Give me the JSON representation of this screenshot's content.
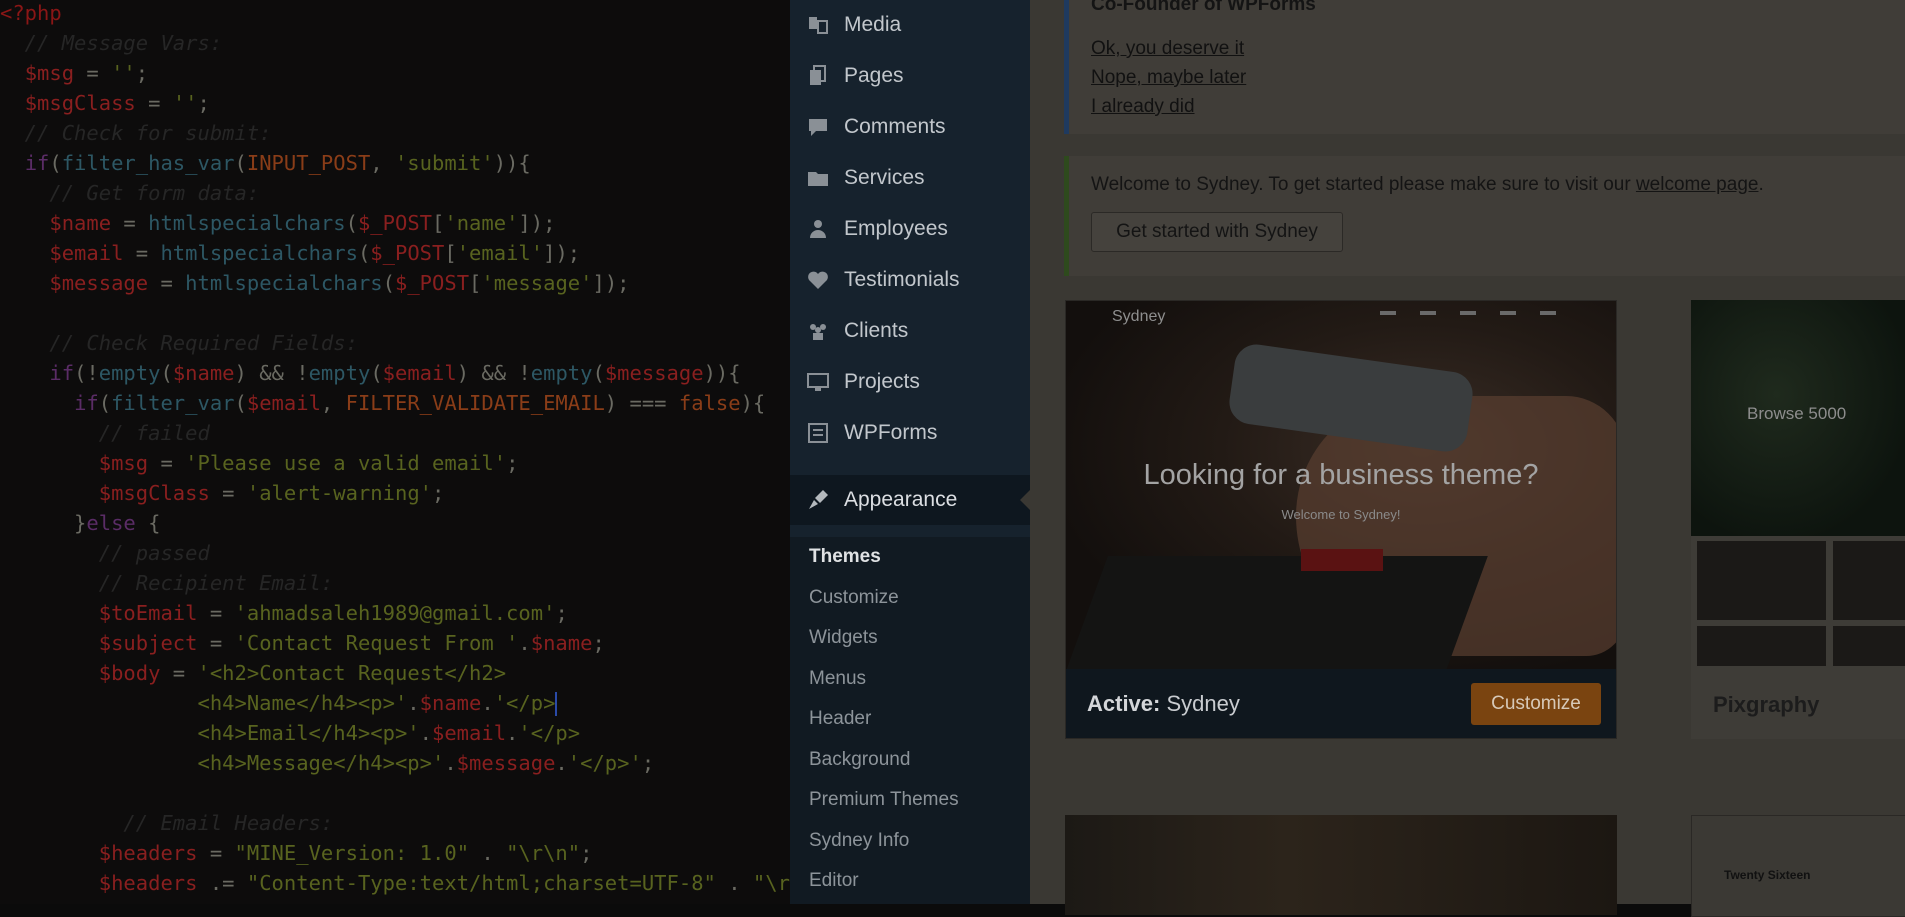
{
  "code": {
    "lines": [
      [
        [
          "tag",
          "<?php"
        ]
      ],
      [
        [
          "cmt",
          "  // Message Vars:"
        ]
      ],
      [
        [
          "pun",
          "  "
        ],
        [
          "var",
          "$msg"
        ],
        [
          "pun",
          " = "
        ],
        [
          "str",
          "''"
        ],
        [
          "pun",
          ";"
        ]
      ],
      [
        [
          "pun",
          "  "
        ],
        [
          "var",
          "$msgClass"
        ],
        [
          "pun",
          " = "
        ],
        [
          "str",
          "''"
        ],
        [
          "pun",
          ";"
        ]
      ],
      [
        [
          "cmt",
          "  // Check for submit:"
        ]
      ],
      [
        [
          "pun",
          "  "
        ],
        [
          "kw",
          "if"
        ],
        [
          "pun",
          "("
        ],
        [
          "fn",
          "filter_has_var"
        ],
        [
          "pun",
          "("
        ],
        [
          "const",
          "INPUT_POST"
        ],
        [
          "pun",
          ", "
        ],
        [
          "str",
          "'submit'"
        ],
        [
          "pun",
          "))"
        ],
        [
          "pun",
          "{"
        ]
      ],
      [
        [
          "cmt",
          "    // Get form data:"
        ]
      ],
      [
        [
          "pun",
          "    "
        ],
        [
          "var",
          "$name"
        ],
        [
          "pun",
          " = "
        ],
        [
          "fn",
          "htmlspecialchars"
        ],
        [
          "pun",
          "("
        ],
        [
          "var",
          "$_POST"
        ],
        [
          "pun",
          "["
        ],
        [
          "str",
          "'name'"
        ],
        [
          "pun",
          "]);"
        ]
      ],
      [
        [
          "pun",
          "    "
        ],
        [
          "var",
          "$email"
        ],
        [
          "pun",
          " = "
        ],
        [
          "fn",
          "htmlspecialchars"
        ],
        [
          "pun",
          "("
        ],
        [
          "var",
          "$_POST"
        ],
        [
          "pun",
          "["
        ],
        [
          "str",
          "'email'"
        ],
        [
          "pun",
          "]);"
        ]
      ],
      [
        [
          "pun",
          "    "
        ],
        [
          "var",
          "$message"
        ],
        [
          "pun",
          " = "
        ],
        [
          "fn",
          "htmlspecialchars"
        ],
        [
          "pun",
          "("
        ],
        [
          "var",
          "$_POST"
        ],
        [
          "pun",
          "["
        ],
        [
          "str",
          "'message'"
        ],
        [
          "pun",
          "]);"
        ]
      ],
      [
        [
          "pun",
          ""
        ]
      ],
      [
        [
          "cmt",
          "    // Check Required Fields:"
        ]
      ],
      [
        [
          "pun",
          "    "
        ],
        [
          "kw",
          "if"
        ],
        [
          "pun",
          "(!"
        ],
        [
          "fn",
          "empty"
        ],
        [
          "pun",
          "("
        ],
        [
          "var",
          "$name"
        ],
        [
          "pun",
          ") && !"
        ],
        [
          "fn",
          "empty"
        ],
        [
          "pun",
          "("
        ],
        [
          "var",
          "$email"
        ],
        [
          "pun",
          ") && !"
        ],
        [
          "fn",
          "empty"
        ],
        [
          "pun",
          "("
        ],
        [
          "var",
          "$message"
        ],
        [
          "pun",
          "))"
        ],
        [
          "pun",
          "{"
        ]
      ],
      [
        [
          "pun",
          "      "
        ],
        [
          "kw",
          "if"
        ],
        [
          "pun",
          "("
        ],
        [
          "fn",
          "filter_var"
        ],
        [
          "pun",
          "("
        ],
        [
          "var",
          "$email"
        ],
        [
          "pun",
          ", "
        ],
        [
          "const",
          "FILTER_VALIDATE_EMAIL"
        ],
        [
          "pun",
          ") === "
        ],
        [
          "const",
          "false"
        ],
        [
          "pun",
          "){"
        ]
      ],
      [
        [
          "cmt",
          "        // failed"
        ]
      ],
      [
        [
          "pun",
          "        "
        ],
        [
          "var",
          "$msg"
        ],
        [
          "pun",
          " = "
        ],
        [
          "str",
          "'Please use a valid email'"
        ],
        [
          "pun",
          ";"
        ]
      ],
      [
        [
          "pun",
          "        "
        ],
        [
          "var",
          "$msgClass"
        ],
        [
          "pun",
          " = "
        ],
        [
          "str",
          "'alert-warning'"
        ],
        [
          "pun",
          ";"
        ]
      ],
      [
        [
          "pun",
          "      }"
        ],
        [
          "kw",
          "else"
        ],
        [
          "pun",
          " {"
        ]
      ],
      [
        [
          "cmt",
          "        // passed"
        ]
      ],
      [
        [
          "cmt",
          "        // Recipient Email:"
        ]
      ],
      [
        [
          "pun",
          "        "
        ],
        [
          "var",
          "$toEmail"
        ],
        [
          "pun",
          " = "
        ],
        [
          "str",
          "'ahmadsaleh1989@gmail.com'"
        ],
        [
          "pun",
          ";"
        ]
      ],
      [
        [
          "pun",
          "        "
        ],
        [
          "var",
          "$subject"
        ],
        [
          "pun",
          " = "
        ],
        [
          "str",
          "'Contact Request From '"
        ],
        [
          "pun",
          "."
        ],
        [
          "var",
          "$name"
        ],
        [
          "pun",
          ";"
        ]
      ],
      [
        [
          "pun",
          "        "
        ],
        [
          "var",
          "$body"
        ],
        [
          "pun",
          " = "
        ],
        [
          "str",
          "'<h2>Contact Request</h2>"
        ]
      ],
      [
        [
          "str",
          "                <h4>Name</h4><p>'"
        ],
        [
          "pun",
          "."
        ],
        [
          "var",
          "$name"
        ],
        [
          "pun",
          "."
        ],
        [
          "str",
          "'</p>"
        ],
        [
          "cursor",
          ""
        ]
      ],
      [
        [
          "str",
          "                <h4>Email</h4><p>'"
        ],
        [
          "pun",
          "."
        ],
        [
          "var",
          "$email"
        ],
        [
          "pun",
          "."
        ],
        [
          "str",
          "'</p>"
        ]
      ],
      [
        [
          "str",
          "                <h4>Message</h4><p>'"
        ],
        [
          "pun",
          "."
        ],
        [
          "var",
          "$message"
        ],
        [
          "pun",
          "."
        ],
        [
          "str",
          "'</p>'"
        ],
        [
          "pun",
          ";"
        ]
      ],
      [
        [
          "pun",
          ""
        ]
      ],
      [
        [
          "cmt",
          "          // Email Headers:"
        ]
      ],
      [
        [
          "pun",
          "        "
        ],
        [
          "var",
          "$headers"
        ],
        [
          "pun",
          " = "
        ],
        [
          "str",
          "\"MINE_Version: 1.0\""
        ],
        [
          "pun",
          " . "
        ],
        [
          "str",
          "\"\\r\\n\""
        ],
        [
          "pun",
          ";"
        ]
      ],
      [
        [
          "pun",
          "        "
        ],
        [
          "var",
          "$headers"
        ],
        [
          "pun",
          " .= "
        ],
        [
          "str",
          "\"Content-Type:text/html;charset=UTF-8\""
        ],
        [
          "pun",
          " . "
        ],
        [
          "str",
          "\"\\r\\"
        ]
      ]
    ]
  },
  "sidebar": {
    "items": [
      {
        "label": "Media",
        "icon": "media-icon"
      },
      {
        "label": "Pages",
        "icon": "pages-icon"
      },
      {
        "label": "Comments",
        "icon": "comments-icon"
      },
      {
        "label": "Services",
        "icon": "folder-icon"
      },
      {
        "label": "Employees",
        "icon": "users-icon"
      },
      {
        "label": "Testimonials",
        "icon": "heart-icon"
      },
      {
        "label": "Clients",
        "icon": "group-icon"
      },
      {
        "label": "Projects",
        "icon": "desktop-icon"
      },
      {
        "label": "WPForms",
        "icon": "form-icon"
      }
    ],
    "appearance": {
      "label": "Appearance",
      "icon": "paintbrush-icon"
    },
    "submenu": [
      "Themes",
      "Customize",
      "Widgets",
      "Menus",
      "Header",
      "Background",
      "Premium Themes",
      "Sydney Info",
      "Editor"
    ]
  },
  "notices": {
    "review": {
      "heading": "Co-Founder of WPForms",
      "links": [
        "Ok, you deserve it",
        "Nope, maybe later",
        "I already did"
      ]
    },
    "welcome": {
      "text_before": "Welcome to Sydney. To get started please make sure to visit our ",
      "link": "welcome page",
      "text_after": ".",
      "button": "Get started with Sydney"
    }
  },
  "themes": {
    "active": {
      "screenshot_logo": "Sydney",
      "screenshot_headline": "Looking for a business theme?",
      "screenshot_sub": "Welcome to Sydney!",
      "active_prefix": "Active:",
      "name": "Sydney",
      "customize": "Customize"
    },
    "second": {
      "name": "Pixgraphy",
      "screenshot_text": "Browse 5000"
    },
    "bottom_right": {
      "screenshot_title": "Twenty Sixteen"
    }
  },
  "colors": {
    "sidebar_bg": "#16222d",
    "customize_button": "#7a4410",
    "editor_bg": "#0d0c0c"
  }
}
